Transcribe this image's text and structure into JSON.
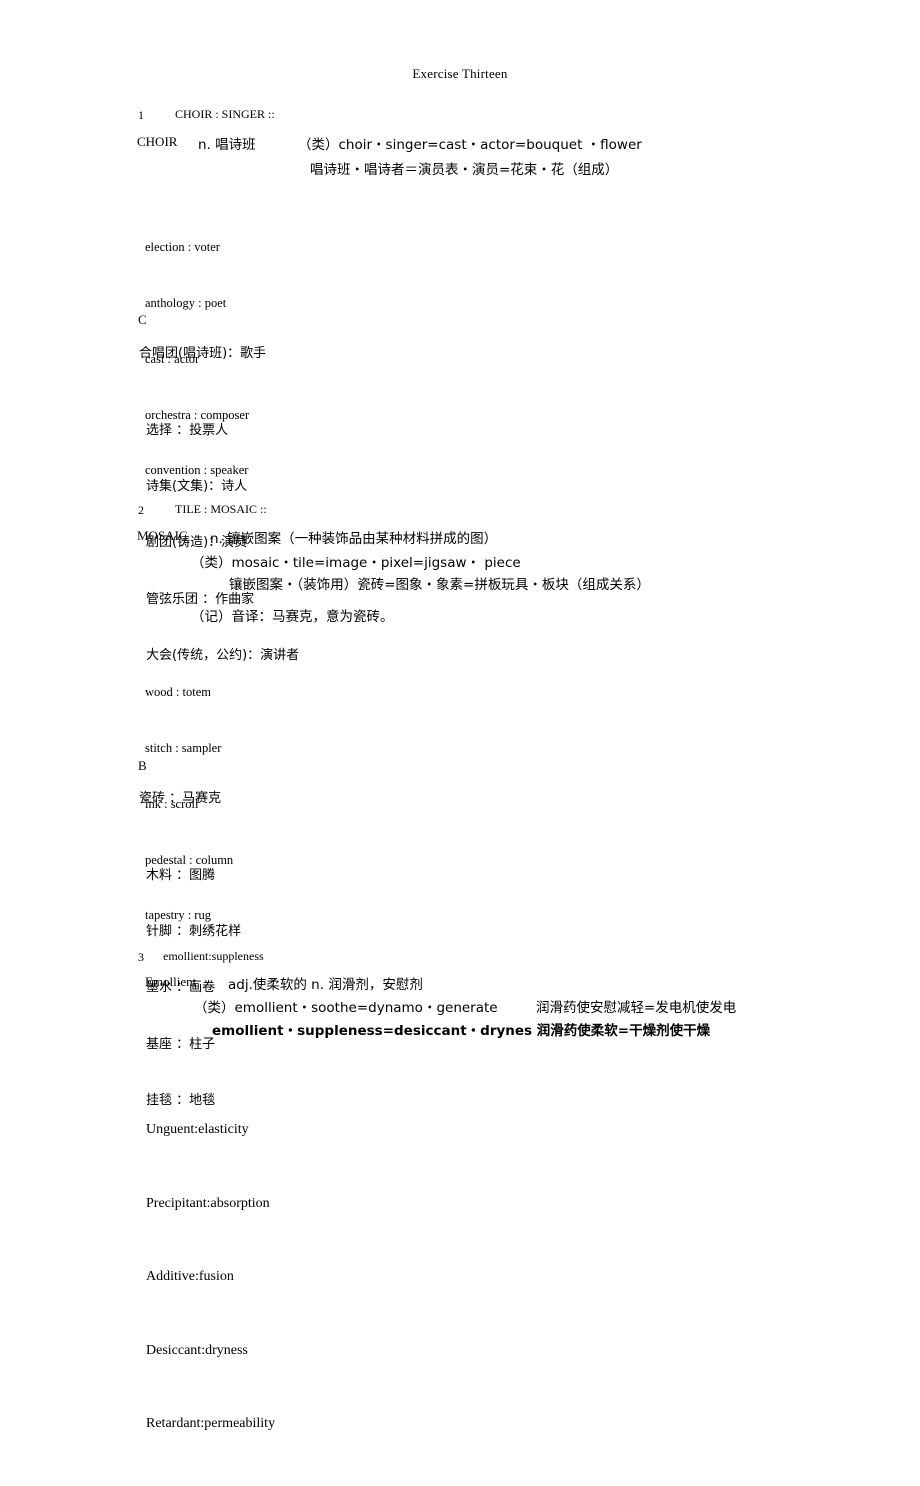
{
  "document": {
    "title": "Exercise Thirteen"
  },
  "entries": [
    {
      "number": "1",
      "prompt": "CHOIR : SINGER ::",
      "headword": "CHOIR",
      "pos_gloss": "n. 唱诗班",
      "analysis_en": "（类）choir・singer=cast・actor=bouquet ・flower",
      "analysis_cn": "唱诗班・唱诗者＝演员表・演员=花束・花（组成）",
      "options_en": [
        "election : voter",
        "anthology : poet",
        "cast : actor",
        "orchestra : composer",
        "convention : speaker"
      ],
      "answer": "C",
      "stem_cn": "合唱团(唱诗班)：歌手",
      "options_cn": [
        "选择 ：投票人",
        "诗集(文集)：诗人",
        "剧团(铸造)：演员",
        "管弦乐团 ：作曲家",
        "大会(传统，公约)：演讲者"
      ]
    },
    {
      "number": "2",
      "prompt": "TILE : MOSAIC ::",
      "headword": "MOSAIC",
      "pos_gloss": "n. 镶嵌图案（一种装饰品由某种材料拼成的图）",
      "analysis_en": "（类）mosaic・tile=image・pixel=jigsaw・ piece",
      "analysis_cn": "镶嵌图案・（装饰用）瓷砖=图象・象素=拼板玩具・板块（组成关系）",
      "mnemonic": "（记）音译：马赛克，意为瓷砖。",
      "options_en": [
        "wood : totem",
        "stitch : sampler",
        "ink : scroll",
        "pedestal : column",
        "tapestry : rug"
      ],
      "answer": "B",
      "stem_cn": "瓷砖 ：马赛克",
      "options_cn": [
        "木料 ：图腾",
        "针脚 ：刺绣花样",
        "墨水 ：画卷",
        "基座 ：柱子",
        "挂毯 ：地毯"
      ]
    },
    {
      "number": "3",
      "prompt": "emollient:suppleness",
      "headword": "Emollient",
      "pos_gloss": "adj.使柔软的 n. 润滑剂，安慰剂",
      "analysis_en": "（类）emollient・soothe=dynamo・generate",
      "analysis_en_cn": "润滑药使安慰减轻=发电机使发电",
      "analysis_bold": "emollient・suppleness=desiccant・drynes 润滑药使柔软=干燥剂使干燥",
      "options_en": [
        "Unguent:elasticity",
        "Precipitant:absorption",
        "Additive:fusion",
        "Desiccant:dryness",
        "Retardant:permeability"
      ]
    }
  ]
}
